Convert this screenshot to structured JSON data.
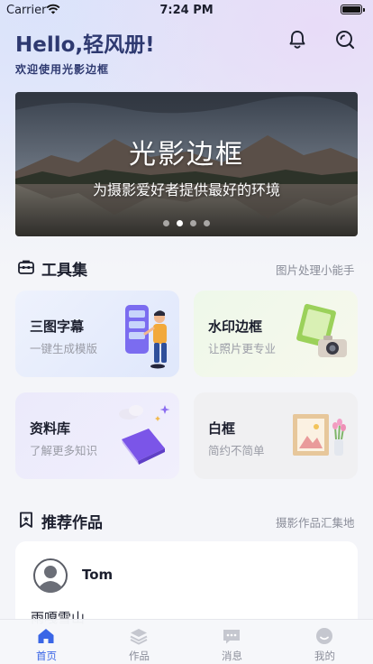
{
  "status_bar": {
    "carrier": "Carrier",
    "time": "7:24 PM"
  },
  "header": {
    "greeting": "Hello,轻风册!",
    "subtitle": "欢迎使用光影边框",
    "bell_icon": "bell-icon",
    "search_icon": "search-icon"
  },
  "banner": {
    "title": "光影边框",
    "subtitle": "为摄影爱好者提供最好的环境",
    "slide_count": 4,
    "active_slide": 2
  },
  "tools": {
    "title": "工具集",
    "link": "图片处理小能手",
    "cards": [
      {
        "title": "三图字幕",
        "subtitle": "一键生成模版"
      },
      {
        "title": "水印边框",
        "subtitle": "让照片更专业"
      },
      {
        "title": "资料库",
        "subtitle": "了解更多知识"
      },
      {
        "title": "白框",
        "subtitle": "简约不简单"
      }
    ]
  },
  "recommended": {
    "title": "推荐作品",
    "link": "摄影作品汇集地",
    "item": {
      "author": "Tom",
      "title": "雨嘎雪山"
    }
  },
  "tabbar": {
    "items": [
      {
        "label": "首页"
      },
      {
        "label": "作品"
      },
      {
        "label": "消息"
      },
      {
        "label": "我的"
      }
    ],
    "active": 0
  },
  "colors": {
    "accent": "#3a66e6",
    "heading": "#2e3970",
    "muted": "#8a8d99"
  }
}
